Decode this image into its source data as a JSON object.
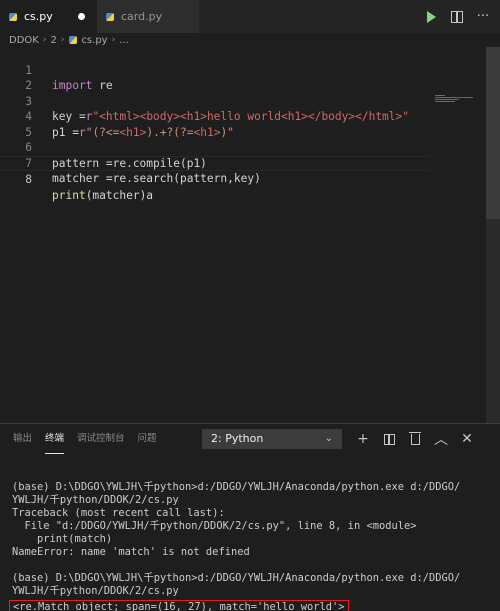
{
  "tabs": [
    {
      "label": "cs.py",
      "active": true,
      "modified": true
    },
    {
      "label": "card.py",
      "active": false,
      "modified": false
    }
  ],
  "breadcrumb": [
    "DDOK",
    "2",
    "cs.py",
    "..."
  ],
  "editor": {
    "lines": [
      {
        "n": "1"
      },
      {
        "n": "2"
      },
      {
        "n": "3"
      },
      {
        "n": "4"
      },
      {
        "n": "5"
      },
      {
        "n": "6"
      },
      {
        "n": "7"
      },
      {
        "n": "8"
      }
    ],
    "code": {
      "l1_kw": "import",
      "l1_rest": " re",
      "l3_a": "key =",
      "l3_prefix": "r",
      "l3_str": "\"<html><body><h1>hello world<h1></body></html>\"",
      "l4_a": "p1 =",
      "l4_prefix": "r",
      "l4_s1": "\"(?<=",
      "l4_s2": "<h1>",
      "l4_s3": ").+?(?=",
      "l4_s4": "<h1>",
      "l4_s5": ")\"",
      "l6": "pattern =re.compile(p1)",
      "l7": "matcher =re.search(pattern,key)",
      "l8_fn": "print",
      "l8_rest": "(matcher)a"
    }
  },
  "panel": {
    "tabs": [
      "输出",
      "终端",
      "调试控制台",
      "问题"
    ],
    "active_tab": "终端",
    "terminal_select": "2: Python",
    "terminal_lines": [
      "",
      "(base) D:\\DDGO\\YWLJH\\千python>d:/DDGO/YWLJH/Anaconda/python.exe d:/DDGO/",
      "YWLJH/千python/DDOK/2/cs.py",
      "Traceback (most recent call last):",
      "  File \"d:/DDGO/YWLJH/千python/DDOK/2/cs.py\", line 8, in <module>",
      "    print(match)",
      "NameError: name 'match' is not defined",
      "",
      "(base) D:\\DDGO\\YWLJH\\千python>d:/DDGO/YWLJH/Anaconda/python.exe d:/DDGO/",
      "YWLJH/千python/DDOK/2/cs.py"
    ],
    "result_line": "<re.Match object; span=(16, 27), match='hello world'>"
  },
  "colors": {
    "accent_run": "#89d185",
    "highlight_box": "#e02020"
  }
}
